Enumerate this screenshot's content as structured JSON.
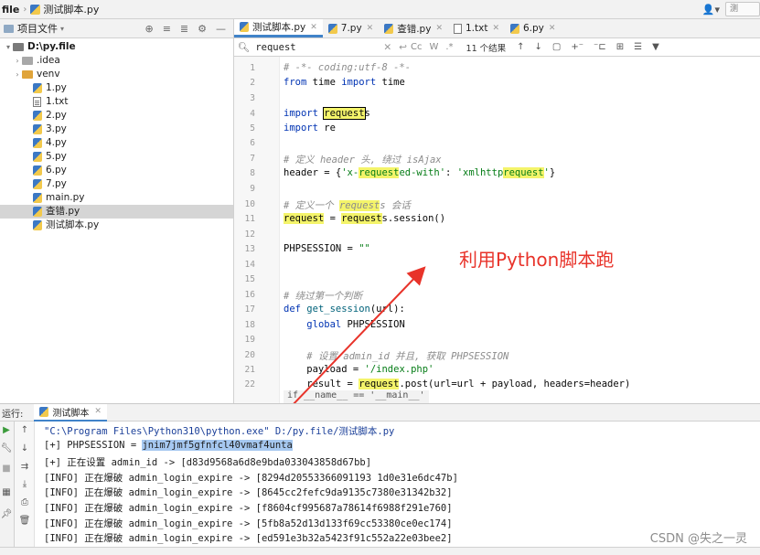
{
  "nav": {
    "root": "file",
    "file": "测试脚本.py",
    "user_icon": "person-icon"
  },
  "project": {
    "title": "项目文件",
    "tree": [
      {
        "label": "D:\\py.file",
        "kind": "root"
      },
      {
        "label": ".idea",
        "kind": "folder"
      },
      {
        "label": "venv",
        "kind": "folder-orange"
      },
      {
        "label": "1.py",
        "kind": "py"
      },
      {
        "label": "1.txt",
        "kind": "txt"
      },
      {
        "label": "2.py",
        "kind": "py"
      },
      {
        "label": "3.py",
        "kind": "py"
      },
      {
        "label": "4.py",
        "kind": "py"
      },
      {
        "label": "5.py",
        "kind": "py"
      },
      {
        "label": "6.py",
        "kind": "py"
      },
      {
        "label": "7.py",
        "kind": "py"
      },
      {
        "label": "main.py",
        "kind": "py"
      },
      {
        "label": "查错.py",
        "kind": "py",
        "selected": true
      },
      {
        "label": "测试脚本.py",
        "kind": "py"
      }
    ]
  },
  "tabs": [
    {
      "label": "测试脚本.py",
      "active": true,
      "kind": "py"
    },
    {
      "label": "7.py",
      "kind": "py"
    },
    {
      "label": "查错.py",
      "kind": "py"
    },
    {
      "label": "1.txt",
      "kind": "txt"
    },
    {
      "label": "6.py",
      "kind": "py"
    }
  ],
  "search": {
    "query": "request",
    "case_label": "Cc",
    "word_label": "W",
    "regex_label": ".*",
    "result_count": "11 个结果"
  },
  "code": {
    "line_numbers": [
      "1",
      "2",
      "3",
      "4",
      "5",
      "6",
      "7",
      "8",
      "9",
      "10",
      "11",
      "12",
      "13",
      "14",
      "15",
      "16",
      "17",
      "18",
      "19",
      "20",
      "21",
      "22"
    ],
    "hint": "if __name__ == '__main__'",
    "annotation": "利用Python脚本跑"
  },
  "run": {
    "label": "运行:",
    "tab": "测试脚本",
    "lines": [
      "\"C:\\Program Files\\Python310\\python.exe\" D:/py.file/测试脚本.py",
      "[+] PHPSESSION = jnim7jmf5gfnfcl40vmaf4unta",
      "[+] 正在设置 admin_id -> [d83d9568a6d8e9bda033043858d67bb]",
      "[INFO] 正在爆破 admin_login_expire -> [8294d20553366091193 1d0e31e6dc47b]",
      "[INFO] 正在爆破 admin_login_expire -> [8645cc2fefc9da9135c7380e31342b32]",
      "[INFO] 正在爆破 admin_login_expire -> [f8604cf995687a78614f6988f291e760]",
      "[INFO] 正在爆破 admin_login_expire -> [5fb8a52d13d133f69cc53380ce0ec174]",
      "[INFO] 正在爆破 admin_login_expire -> [ed591e3b32a5423f91c552a22e03bee2]"
    ],
    "session_prefix": "[+] PHPSESSION = ",
    "session_value": "jnim7jmf5gfnfcl40vmaf4unta"
  },
  "watermark": "CSDN @失之一灵"
}
